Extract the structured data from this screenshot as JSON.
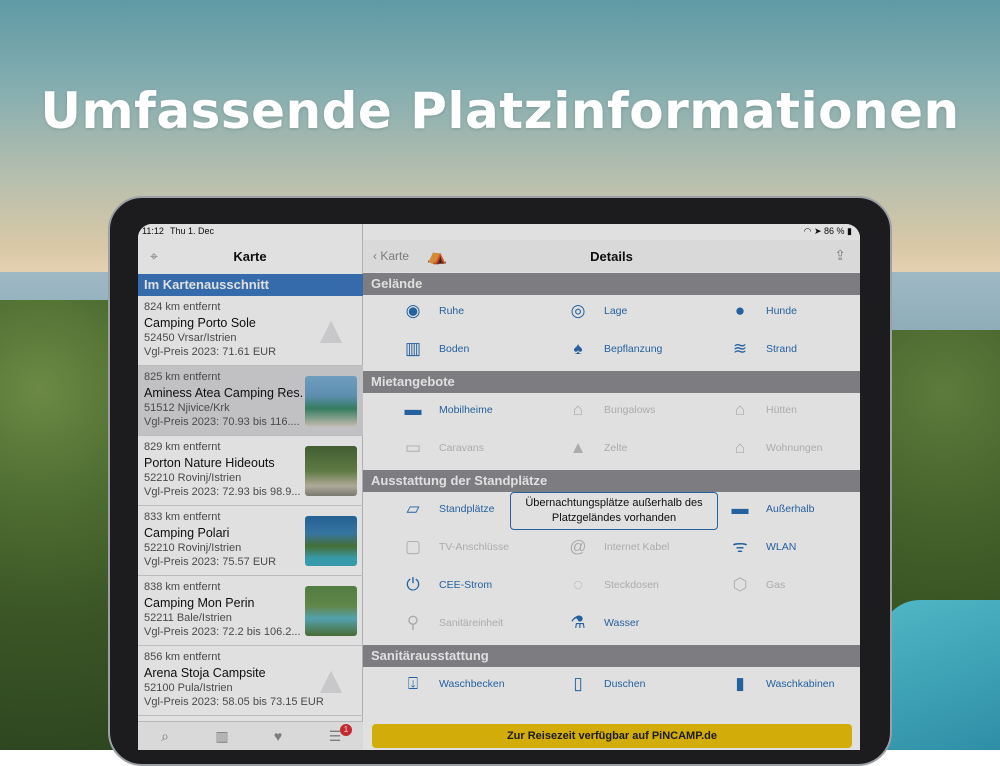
{
  "headline": "Umfassende Platzinformationen",
  "status": {
    "time": "11:12",
    "date": "Thu 1. Dec",
    "battery": "86 %"
  },
  "left": {
    "title": "Karte",
    "section": "Im Kartenausschnitt",
    "items": [
      {
        "dist": "824 km entfernt",
        "name": "Camping Porto Sole",
        "city": "52450 Vrsar/Istrien",
        "price": "Vgl-Preis 2023: 71.61 EUR",
        "thumb": "tent"
      },
      {
        "dist": "825 km entfernt",
        "name": "Aminess Atea Camping Res...",
        "city": "51512 Njivice/Krk",
        "price": "Vgl-Preis 2023: 70.93 bis 116....",
        "thumb": "photo"
      },
      {
        "dist": "829 km entfernt",
        "name": "Porton Nature Hideouts",
        "city": "52210 Rovinj/Istrien",
        "price": "Vgl-Preis 2023: 72.93 bis 98.9...",
        "thumb": "photo"
      },
      {
        "dist": "833 km entfernt",
        "name": "Camping Polari",
        "city": "52210 Rovinj/Istrien",
        "price": "Vgl-Preis 2023: 75.57 EUR",
        "thumb": "photo"
      },
      {
        "dist": "838 km entfernt",
        "name": "Camping Mon Perin",
        "city": "52211 Bale/Istrien",
        "price": "Vgl-Preis 2023: 72.2 bis 106.2...",
        "thumb": "photo"
      },
      {
        "dist": "856 km entfernt",
        "name": "Arena Stoja Campsite",
        "city": "52100 Pula/Istrien",
        "price": "Vgl-Preis 2023: 58.05 bis 73.15 EUR",
        "thumb": "tent"
      }
    ],
    "badge": "1"
  },
  "right": {
    "back_label": "Karte",
    "title": "Details",
    "sections": {
      "gelaende": "Gelände",
      "miet": "Mietangebote",
      "ausstattung": "Ausstattung der Standplätze",
      "sanitaer": "Sanitärausstattung"
    },
    "features": {
      "ruhe": "Ruhe",
      "lage": "Lage",
      "hunde": "Hunde",
      "boden": "Boden",
      "bepflanzung": "Bepflanzung",
      "strand": "Strand",
      "mobilheime": "Mobilheime",
      "bungalows": "Bungalows",
      "huetten": "Hütten",
      "caravans": "Caravans",
      "zelte": "Zelte",
      "wohnungen": "Wohnungen",
      "standplaetze": "Standplätze",
      "ausserhalb": "Außerhalb",
      "tv": "TV-Anschlüsse",
      "internet": "Internet Kabel",
      "wlan": "WLAN",
      "cee": "CEE-Strom",
      "steckdosen": "Steckdosen",
      "gas": "Gas",
      "sanitaereinheit": "Sanitäreinheit",
      "wasser": "Wasser",
      "waschbecken": "Waschbecken",
      "duschen": "Duschen",
      "waschkabinen": "Waschkabinen"
    },
    "tooltip": "Übernachtungsplätze außerhalb des Platzgeländes vorhanden",
    "cta": "Zur Reisezeit verfügbar auf PiNCAMP.de"
  }
}
